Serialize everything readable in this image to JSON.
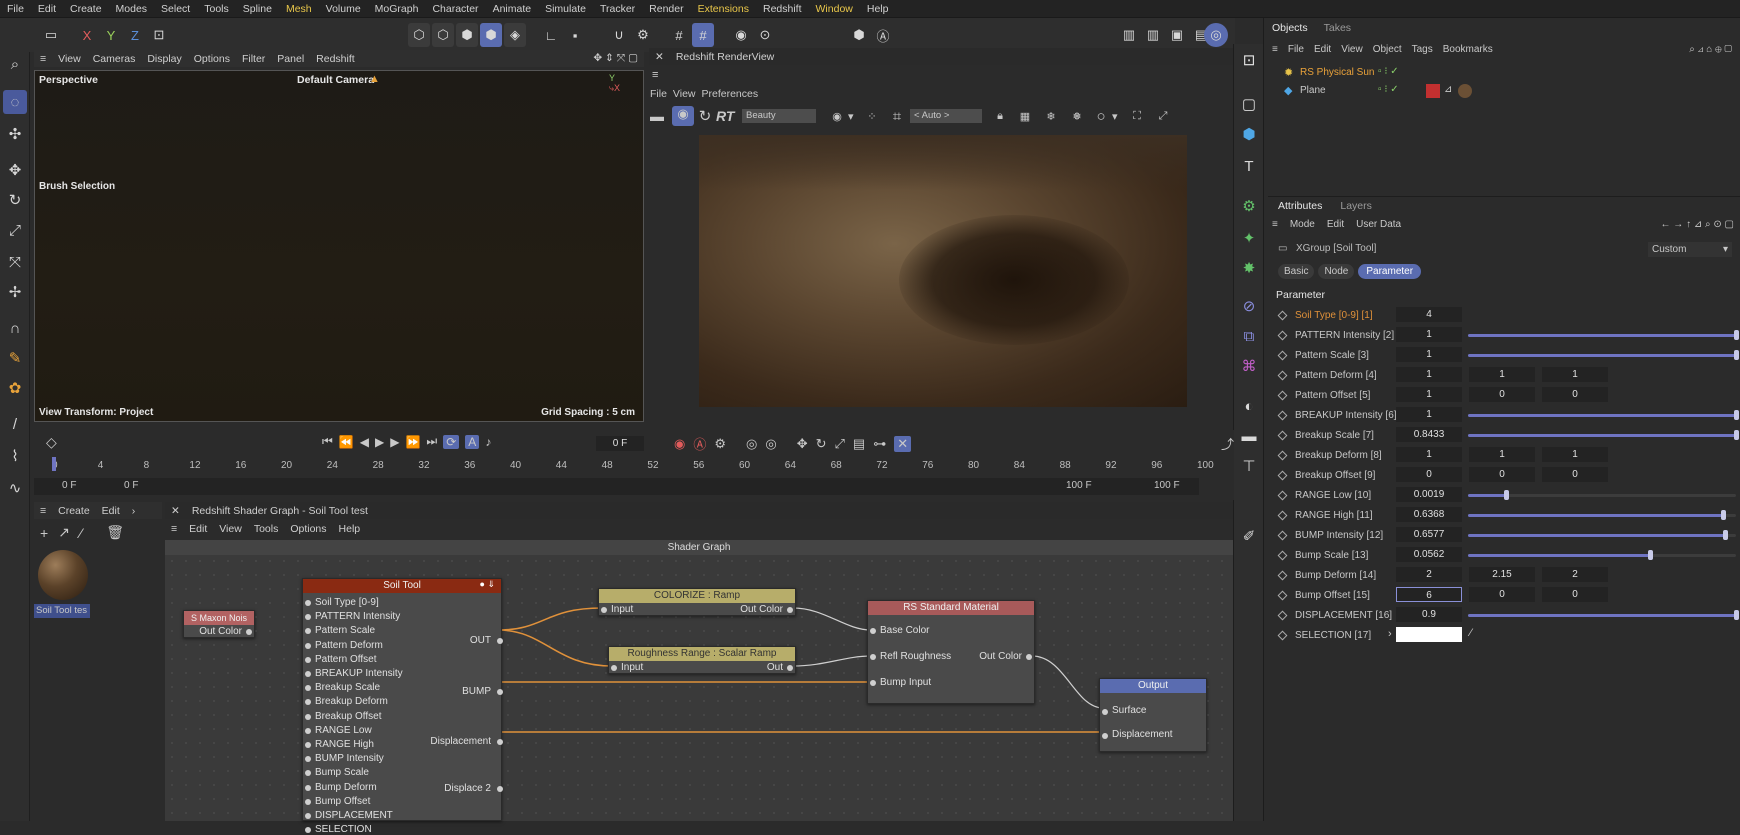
{
  "menu": [
    "File",
    "Edit",
    "Create",
    "Modes",
    "Select",
    "Tools",
    "Spline",
    "Mesh",
    "Volume",
    "MoGraph",
    "Character",
    "Animate",
    "Simulate",
    "Tracker",
    "Render",
    "Extensions",
    "Redshift",
    "Window",
    "Help"
  ],
  "menu_highlight": [
    "Mesh",
    "Extensions",
    "Window"
  ],
  "viewport_menu": [
    "View",
    "Cameras",
    "Display",
    "Options",
    "Filter",
    "Panel",
    "Redshift"
  ],
  "viewport": {
    "name": "Perspective",
    "camera": "Default Camera",
    "brush": "Brush Selection",
    "view_transform": "View Transform: Project",
    "grid_spacing": "Grid Spacing : 5 cm"
  },
  "renderview": {
    "title": "Redshift RenderView",
    "menu": [
      "File",
      "View",
      "Preferences"
    ],
    "rt": "RT",
    "aov": "Beauty",
    "auto": "< Auto >"
  },
  "timeline": {
    "ticks": [
      "0",
      "4",
      "8",
      "12",
      "16",
      "20",
      "24",
      "28",
      "32",
      "36",
      "40",
      "44",
      "48",
      "52",
      "56",
      "60",
      "64",
      "68",
      "72",
      "76",
      "80",
      "84",
      "88",
      "92",
      "96",
      "100"
    ],
    "current": "0 F",
    "start1": "0 F",
    "start2": "0 F",
    "end1": "100 F",
    "end2": "100 F"
  },
  "material_panel": {
    "menu": [
      "Create",
      "Edit"
    ],
    "material_name": "Soil Tool tes"
  },
  "shader_graph": {
    "title": "Redshift Shader Graph - Soil Tool test",
    "menu": [
      "Edit",
      "View",
      "Tools",
      "Options",
      "Help"
    ],
    "canvas_title": "Shader Graph",
    "maxon_node": {
      "title": "S Maxon Nois",
      "out": "Out Color"
    },
    "soil_node": {
      "title": "Soil Tool",
      "inputs": [
        "Soil Type [0-9]",
        "PATTERN Intensity",
        "Pattern Scale",
        "Pattern Deform",
        "Pattern Offset",
        "BREAKUP Intensity",
        "Breakup Scale",
        "Breakup Deform",
        "Breakup Offset",
        "RANGE Low",
        "RANGE High",
        "BUMP Intensity",
        "Bump Scale",
        "Bump Deform",
        "Bump Offset",
        "DISPLACEMENT",
        "SELECTION"
      ],
      "outputs": [
        "OUT",
        "BUMP",
        "Displacement",
        "Displace 2"
      ]
    },
    "colorize_node": {
      "title": "COLORIZE : Ramp",
      "in": "Input",
      "out": "Out Color"
    },
    "rough_node": {
      "title": "Roughness Range : Scalar Ramp",
      "in": "Input",
      "out": "Out"
    },
    "std_node": {
      "title": "RS Standard Material",
      "inputs": [
        "Base Color",
        "Refl Roughness",
        "Bump Input"
      ],
      "out": "Out Color"
    },
    "output_node": {
      "title": "Output",
      "inputs": [
        "Surface",
        "Displacement"
      ]
    }
  },
  "objects": {
    "tabs": [
      "Objects",
      "Takes"
    ],
    "menu": [
      "File",
      "Edit",
      "View",
      "Object",
      "Tags",
      "Bookmarks"
    ],
    "items": [
      "RS Physical Sun",
      "Plane"
    ]
  },
  "attributes": {
    "tabs": [
      "Attributes",
      "Layers"
    ],
    "menu": [
      "Mode",
      "Edit",
      "User Data"
    ],
    "object": "XGroup [Soil Tool]",
    "preset": "Custom",
    "subtabs": [
      "Basic",
      "Node",
      "Parameter"
    ],
    "section": "Parameter",
    "params": [
      {
        "label": "Soil Type [0-9] [1]",
        "v": [
          "4"
        ],
        "slider": null
      },
      {
        "label": "PATTERN Intensity [2]",
        "v": [
          "1"
        ],
        "slider": 1.0
      },
      {
        "label": "Pattern Scale [3]",
        "v": [
          "1"
        ],
        "slider": 1.0
      },
      {
        "label": "Pattern Deform [4]",
        "v": [
          "1",
          "1",
          "1"
        ],
        "slider": null
      },
      {
        "label": "Pattern Offset [5]",
        "v": [
          "1",
          "0",
          "0"
        ],
        "slider": null
      },
      {
        "label": "BREAKUP Intensity [6]",
        "v": [
          "1"
        ],
        "slider": 1.0
      },
      {
        "label": "Breakup Scale [7]",
        "v": [
          "0.8433"
        ],
        "slider": 1.0
      },
      {
        "label": "Breakup Deform [8]",
        "v": [
          "1",
          "1",
          "1"
        ],
        "slider": null
      },
      {
        "label": "Breakup Offset [9]",
        "v": [
          "0",
          "0",
          "0"
        ],
        "slider": null
      },
      {
        "label": "RANGE Low [10]",
        "v": [
          "0.0019"
        ],
        "slider": 0.14
      },
      {
        "label": "RANGE High [11]",
        "v": [
          "0.6368"
        ],
        "slider": 0.95
      },
      {
        "label": "BUMP Intensity [12]",
        "v": [
          "0.6577"
        ],
        "slider": 0.96
      },
      {
        "label": "Bump Scale [13]",
        "v": [
          "0.0562"
        ],
        "slider": 0.68
      },
      {
        "label": "Bump Deform [14]",
        "v": [
          "2",
          "2.15",
          "2"
        ],
        "slider": null
      },
      {
        "label": "Bump Offset [15]",
        "v": [
          "6",
          "0",
          "0"
        ],
        "slider": null
      },
      {
        "label": "DISPLACEMENT [16]",
        "v": [
          "0.9"
        ],
        "slider": 1.0
      },
      {
        "label": "SELECTION [17]",
        "v": [
          ""
        ],
        "slider": null
      }
    ]
  },
  "colors": {
    "accent": "#5a6cb0",
    "slider": "#6f74c2",
    "orange": "#e0913a",
    "soil_head": "#8a2a12",
    "ramp_head": "#b7ad6a",
    "std_head": "#a85a5a",
    "output_head": "#5a6cb0"
  }
}
